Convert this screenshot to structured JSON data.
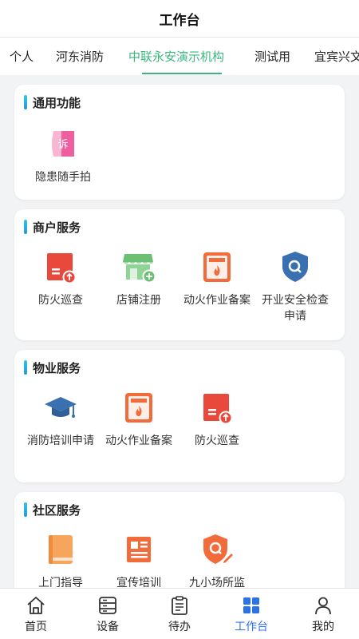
{
  "header": {
    "title": "工作台"
  },
  "tabs": [
    {
      "label": "个人"
    },
    {
      "label": "河东消防"
    },
    {
      "label": "中联永安演示机构",
      "active": true
    },
    {
      "label": "测试用"
    },
    {
      "label": "宜宾兴文"
    }
  ],
  "sections": [
    {
      "title": "通用功能",
      "items": [
        {
          "label": "隐患随手拍",
          "icon": "report-photo-icon"
        }
      ]
    },
    {
      "title": "商户服务",
      "items": [
        {
          "label": "防火巡查",
          "icon": "fire-patrol-icon"
        },
        {
          "label": "店铺注册",
          "icon": "shop-register-icon"
        },
        {
          "label": "动火作业备案",
          "icon": "hot-work-record-icon"
        },
        {
          "label": "开业安全检查申请",
          "icon": "opening-inspection-icon"
        }
      ]
    },
    {
      "title": "物业服务",
      "items": [
        {
          "label": "消防培训申请",
          "icon": "training-cap-icon"
        },
        {
          "label": "动火作业备案",
          "icon": "hot-work-record-icon"
        },
        {
          "label": "防火巡查",
          "icon": "fire-patrol-icon"
        }
      ]
    },
    {
      "title": "社区服务",
      "items": [
        {
          "label": "上门指导",
          "icon": "book-icon"
        },
        {
          "label": "宣传培训",
          "icon": "newspaper-icon"
        },
        {
          "label": "九小场所监",
          "icon": "shield-edit-icon"
        }
      ]
    }
  ],
  "bottom_nav": [
    {
      "label": "首页",
      "icon": "home-icon"
    },
    {
      "label": "设备",
      "icon": "device-icon"
    },
    {
      "label": "待办",
      "icon": "clipboard-icon"
    },
    {
      "label": "工作台",
      "icon": "grid-icon",
      "active": true
    },
    {
      "label": "我的",
      "icon": "user-icon"
    }
  ],
  "colors": {
    "accent_green": "#3bb77e",
    "nav_active": "#2d73e6",
    "icon_red": "#e8493a",
    "icon_orange": "#f26b3a",
    "icon_blue": "#3a6fb0",
    "icon_green": "#6cbf73",
    "icon_pink": "#ee5fa0"
  }
}
